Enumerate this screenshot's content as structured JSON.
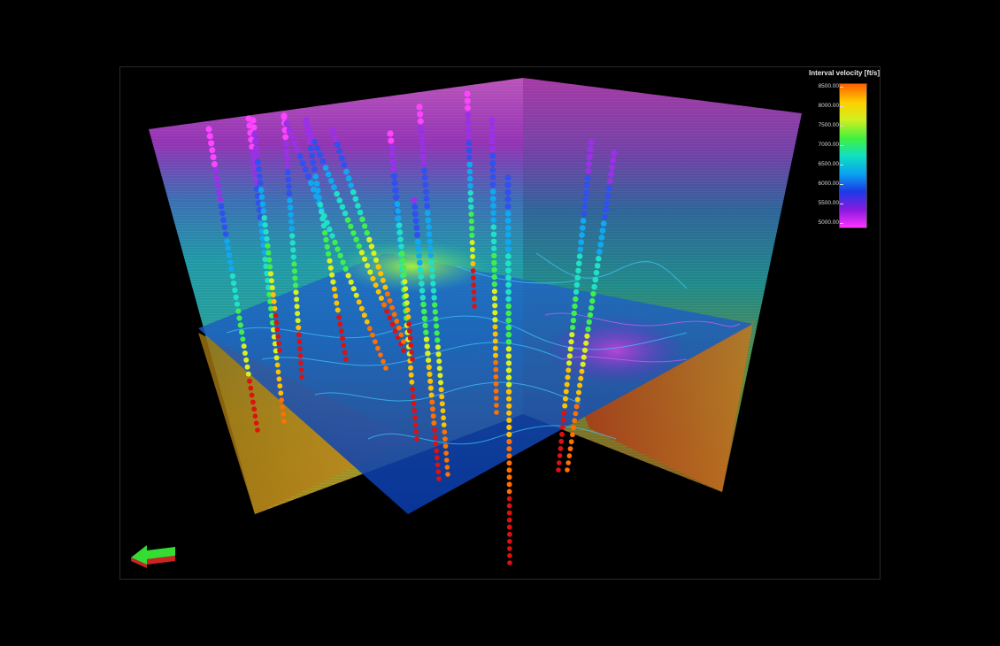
{
  "legend": {
    "title": "Interval velocity [ft/s]",
    "ticks": [
      "8500.00",
      "8000.00",
      "7500.00",
      "7000.00",
      "6500.00",
      "6000.00",
      "5500.00",
      "5000.00"
    ],
    "colors": {
      "high": "#ff6600",
      "mid_high": "#ffff00",
      "mid": "#33ee33",
      "mid_low": "#00dddd",
      "low_mid": "#0066ff",
      "low": "#6600cc",
      "lowest": "#ff33ff"
    }
  },
  "scene": {
    "surface_colors": {
      "top": "#ff44ff",
      "upper": "#3399ee",
      "middle": "#33cccc",
      "lower": "#99cc33",
      "bottom": "#cc9922",
      "horizon": "#1155bb",
      "well_deep": "#dd1111"
    }
  },
  "navigation": {
    "icon": "green-arrow-icon"
  }
}
